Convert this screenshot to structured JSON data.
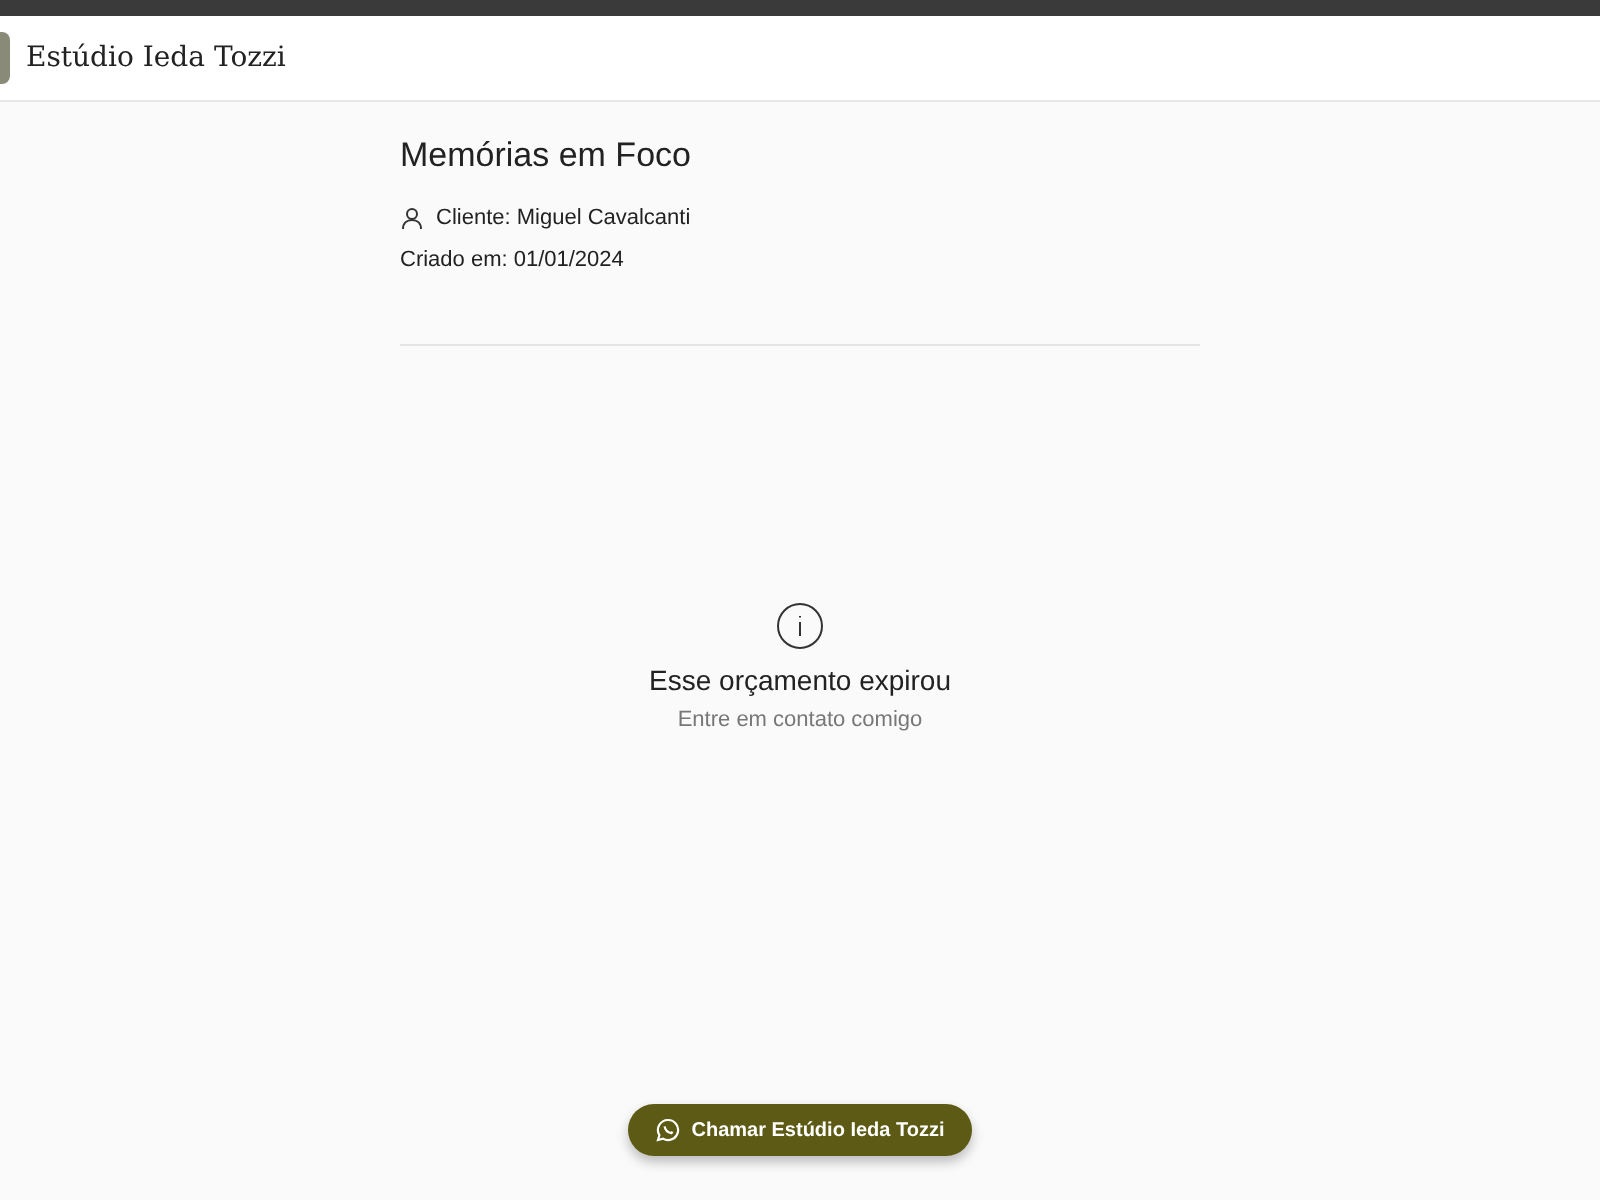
{
  "header": {
    "brand": "Estúdio Ieda Tozzi"
  },
  "project": {
    "title": "Memórias em Foco",
    "client": "Cliente: Miguel Cavalcanti",
    "created": "Criado em: 01/01/2024"
  },
  "notice": {
    "title": "Esse orçamento expirou",
    "subtitle": "Entre em contato comigo"
  },
  "action": {
    "label": "Chamar Estúdio Ieda Tozzi"
  }
}
